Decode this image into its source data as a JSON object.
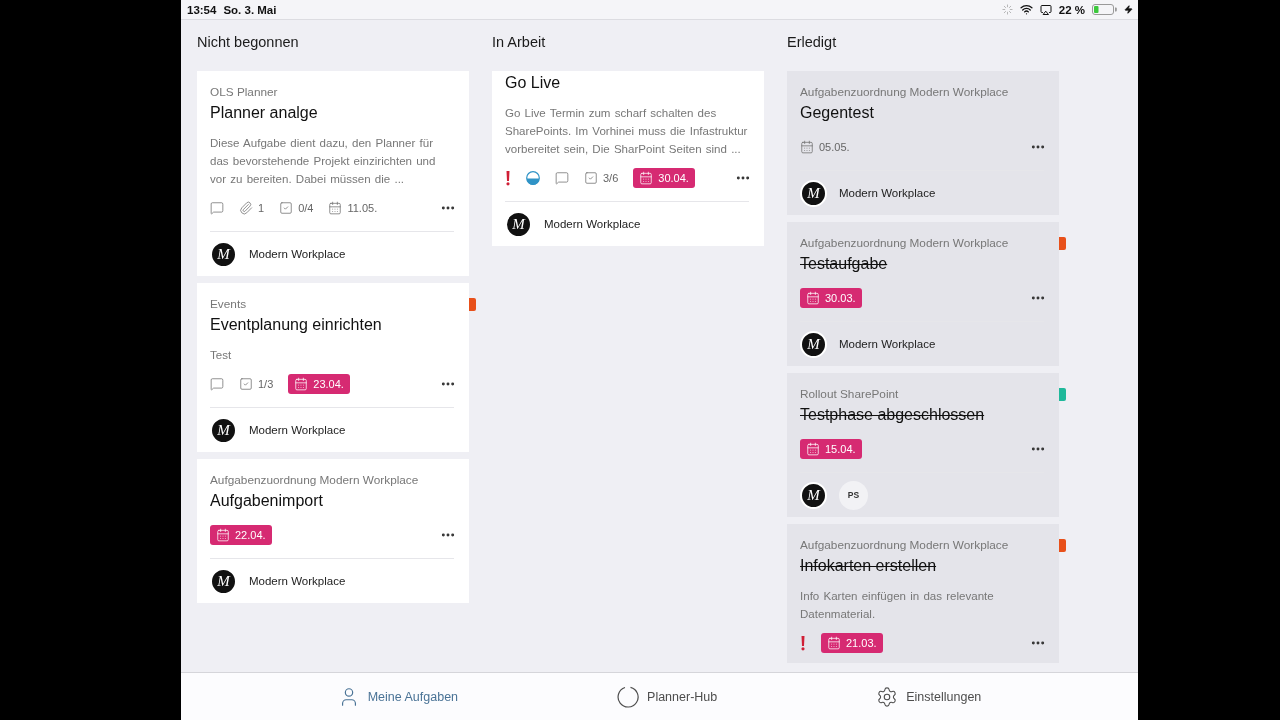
{
  "status_bar": {
    "time": "13:54",
    "date": "So. 3. Mai",
    "battery": "22 %"
  },
  "columns": [
    {
      "title": "Nicht begonnen",
      "done": false,
      "cards": [
        {
          "label": "OLS Planner",
          "title": "Planner analge",
          "completed": false,
          "description": "Diese Aufgabe dient dazu, den Planner für das bevorstehende Projekt einzirichten und vor zu bereiten. Dabei müssen die ...",
          "meta": [
            {
              "kind": "comments"
            },
            {
              "kind": "attachments",
              "text": "1"
            },
            {
              "kind": "checklist",
              "text": "0/4"
            },
            {
              "kind": "date",
              "text": "11.05.",
              "overdue": false
            }
          ],
          "assignees": [
            {
              "kind": "logo",
              "initials": "M",
              "name": "Modern Workplace"
            }
          ]
        },
        {
          "label": "Events",
          "title": "Eventplanung einrichten",
          "completed": false,
          "color": "#e8501a",
          "description": "Test",
          "meta": [
            {
              "kind": "comments"
            },
            {
              "kind": "checklist",
              "text": "1/3"
            },
            {
              "kind": "date",
              "text": "23.04.",
              "overdue": true
            }
          ],
          "assignees": [
            {
              "kind": "logo",
              "initials": "M",
              "name": "Modern Workplace"
            }
          ]
        },
        {
          "label": "Aufgabenzuordnung Modern Workplace",
          "title": "Aufgabenimport",
          "completed": false,
          "meta": [
            {
              "kind": "date",
              "text": "22.04.",
              "overdue": true
            }
          ],
          "assignees": [
            {
              "kind": "logo",
              "initials": "M",
              "name": "Modern Workplace"
            }
          ]
        }
      ]
    },
    {
      "title": "In Arbeit",
      "done": false,
      "cards": [
        {
          "title": "Go Live",
          "completed": false,
          "description": "Go Live Termin zum scharf schalten des SharePoints. Im Vorhinei muss die Infastruktur vorbereitet sein, Die SharPoint Seiten sind ...",
          "meta": [
            {
              "kind": "priority"
            },
            {
              "kind": "progress"
            },
            {
              "kind": "comments"
            },
            {
              "kind": "checklist",
              "text": "3/6"
            },
            {
              "kind": "date",
              "text": "30.04.",
              "overdue": true
            }
          ],
          "assignees": [
            {
              "kind": "logo",
              "initials": "M",
              "name": "Modern Workplace"
            }
          ]
        }
      ]
    },
    {
      "title": "Erledigt",
      "done": true,
      "cards": [
        {
          "label": "Aufgabenzuordnung Modern Workplace",
          "title": "Gegentest",
          "completed": false,
          "meta": [
            {
              "kind": "date",
              "text": "05.05.",
              "overdue": false
            }
          ],
          "assignees": [
            {
              "kind": "logo",
              "initials": "M",
              "name": "Modern Workplace"
            }
          ]
        },
        {
          "label": "Aufgabenzuordnung Modern Workplace",
          "title": "Testaufgabe",
          "completed": true,
          "color": "#e8501a",
          "meta": [
            {
              "kind": "date",
              "text": "30.03.",
              "overdue": true
            }
          ],
          "assignees": [
            {
              "kind": "logo",
              "initials": "M",
              "name": "Modern Workplace"
            }
          ]
        },
        {
          "label": "Rollout SharePoint",
          "title": "Testphase abgeschlossen",
          "completed": true,
          "color": "#1fb89a",
          "meta": [
            {
              "kind": "date",
              "text": "15.04.",
              "overdue": true
            }
          ],
          "assignees": [
            {
              "kind": "logo",
              "initials": "M"
            },
            {
              "kind": "initials",
              "initials": "PS"
            }
          ]
        },
        {
          "label": "Aufgabenzuordnung Modern Workplace",
          "title": "Infokarten erstellen",
          "completed": true,
          "color": "#e8501a",
          "description": "Info Karten einfügen in das relevante Datenmaterial.",
          "meta": [
            {
              "kind": "priority"
            },
            {
              "kind": "date",
              "text": "21.03.",
              "overdue": true
            }
          ]
        }
      ]
    }
  ],
  "tab_bar": [
    {
      "kind": "tasks",
      "label": "Meine Aufgaben",
      "selected": true
    },
    {
      "kind": "hub",
      "label": "Planner-Hub",
      "selected": false
    },
    {
      "kind": "settings",
      "label": "Einstellungen",
      "selected": false
    }
  ]
}
